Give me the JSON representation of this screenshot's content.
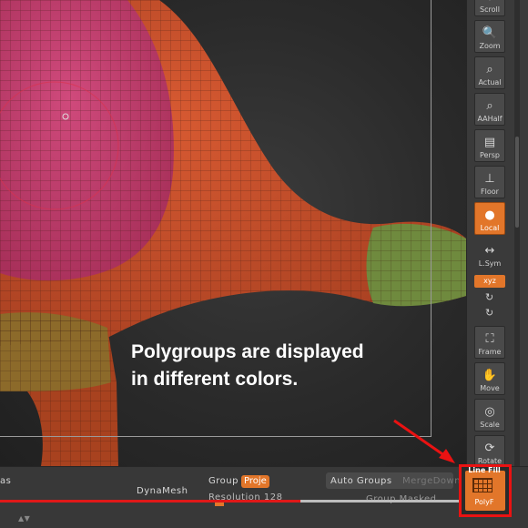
{
  "caption": {
    "line1": "Polygroups are displayed",
    "line2": "in different colors."
  },
  "shelf": {
    "buttons": [
      {
        "label": "Scroll"
      },
      {
        "label": "Zoom"
      },
      {
        "label": "Actual"
      },
      {
        "label": "AAHalf"
      },
      {
        "label": "Persp"
      },
      {
        "label": "Floor"
      },
      {
        "label": "Local"
      },
      {
        "label": "L.Sym"
      },
      {
        "label": "xyz"
      },
      {
        "label": "Frame"
      },
      {
        "label": "Move"
      },
      {
        "label": "Scale"
      },
      {
        "label": "Rotate"
      }
    ]
  },
  "bottom": {
    "left_fragment": "as",
    "dynamesh": "DynaMesh",
    "group": "Group",
    "project": "Proje",
    "resolution": "Resolution 128",
    "auto_groups": "Auto Groups",
    "merge_down": "MergeDown",
    "group_masked": "Group Masked"
  },
  "linefill": {
    "title": "Line Fill",
    "label": "PolyF"
  },
  "colors": {
    "accent": "#e2762a",
    "highlight": "#ea1212"
  }
}
